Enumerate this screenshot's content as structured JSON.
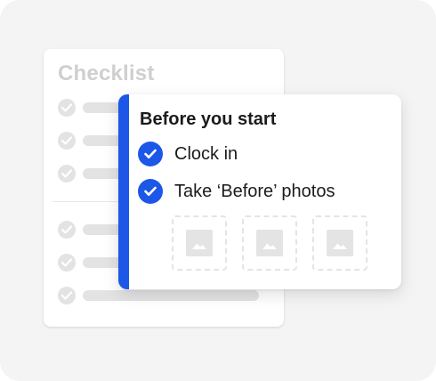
{
  "checklist": {
    "title": "Checklist",
    "rows": 6
  },
  "before_start": {
    "title": "Before you start",
    "tasks": [
      {
        "label": "Clock in",
        "checked": true
      },
      {
        "label": "Take ‘Before’ photos",
        "checked": true
      }
    ],
    "photo_placeholders": 3
  },
  "colors": {
    "accent": "#1c57e8",
    "placeholder_gray": "#e3e3e3",
    "background": "#f4f4f4"
  },
  "icons": {
    "check": "check-icon",
    "photo": "image-placeholder-icon"
  }
}
